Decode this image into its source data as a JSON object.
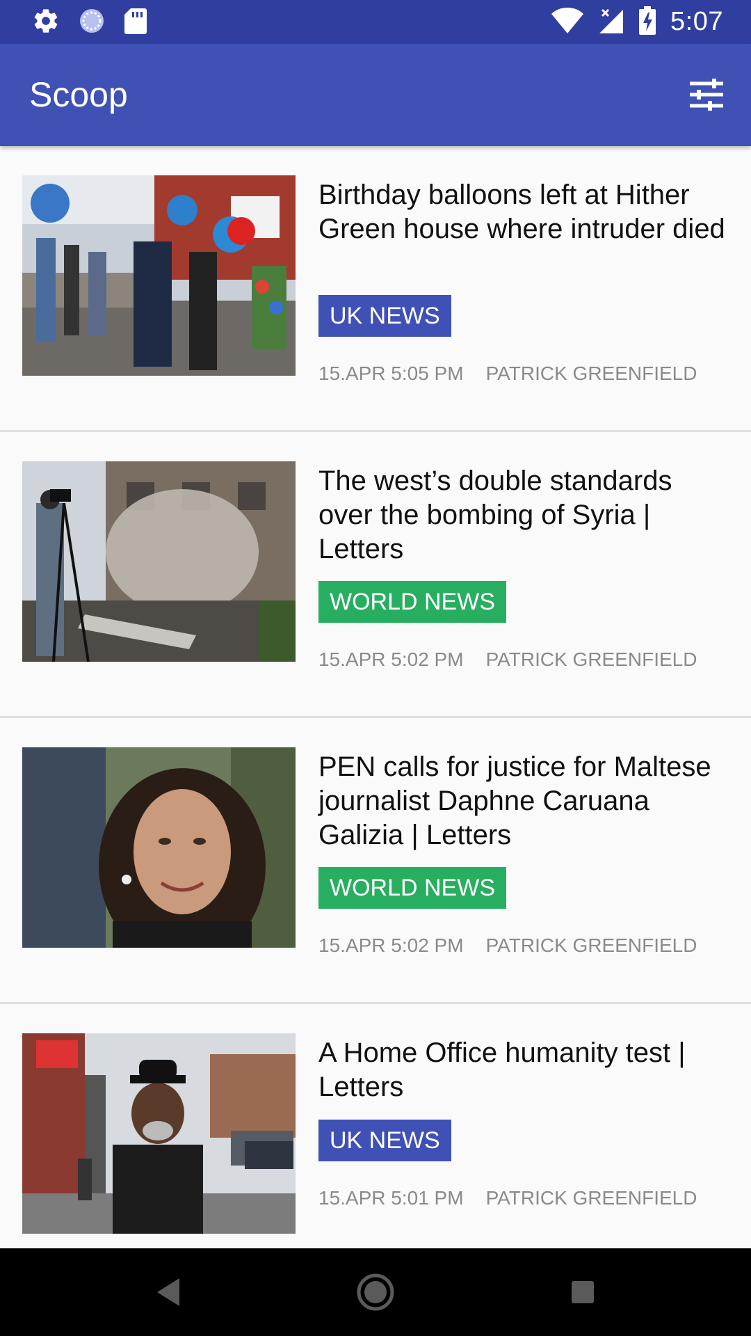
{
  "status_bar": {
    "time": "5:07",
    "left_icons": [
      "settings-icon",
      "sync-icon",
      "sd-card-icon"
    ],
    "right_icons": [
      "wifi-icon",
      "signal-icon",
      "battery-charging-icon"
    ]
  },
  "app_bar": {
    "title": "Scoop",
    "action_icon": "filter-icon"
  },
  "colors": {
    "status_bar": "#303f9f",
    "app_bar": "#3f51b5",
    "uk_news": "#3f51b5",
    "world_news": "#27ae60"
  },
  "articles": [
    {
      "headline": "Birthday balloons left at Hither Green house where intruder died",
      "category": "UK NEWS",
      "date": "15.APR 5:05 PM",
      "author": "PATRICK GREENFIELD"
    },
    {
      "headline": "The west’s double standards over the bombing of Syria | Letters",
      "category": "WORLD NEWS",
      "date": "15.APR 5:02 PM",
      "author": "PATRICK GREENFIELD"
    },
    {
      "headline": "PEN calls for justice for Maltese journalist Daphne Caruana Galizia | Letters",
      "category": "WORLD NEWS",
      "date": "15.APR 5:02 PM",
      "author": "PATRICK GREENFIELD"
    },
    {
      "headline": "A Home Office humanity test | Letters",
      "category": "UK NEWS",
      "date": "15.APR 5:01 PM",
      "author": "PATRICK GREENFIELD"
    }
  ],
  "nav_bar": [
    "back-icon",
    "home-icon",
    "recents-icon"
  ]
}
